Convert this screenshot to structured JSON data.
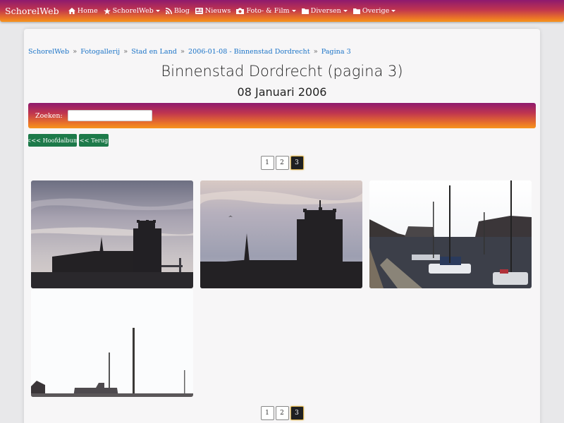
{
  "navbar": {
    "brand": "SchorelWeb",
    "items": [
      {
        "label": "Home",
        "icon": "home-icon",
        "dropdown": false
      },
      {
        "label": "SchorelWeb",
        "icon": "star-icon",
        "dropdown": true
      },
      {
        "label": "Blog",
        "icon": "rss-icon",
        "dropdown": false
      },
      {
        "label": "Nieuws",
        "icon": "newspaper-icon",
        "dropdown": false
      },
      {
        "label": "Foto- & Film",
        "icon": "camera-icon",
        "dropdown": true
      },
      {
        "label": "Diversen",
        "icon": "folder-icon",
        "dropdown": true
      },
      {
        "label": "Overige",
        "icon": "folder-icon",
        "dropdown": true
      }
    ]
  },
  "breadcrumb": {
    "items": [
      "SchorelWeb",
      "Fotogallerij",
      "Stad en Land",
      "2006-01-08 - Binnenstad Dordrecht",
      "Pagina 3"
    ],
    "separator": "»"
  },
  "page": {
    "title": "Binnenstad Dordrecht (pagina 3)",
    "subtitle": "08 Januari 2006"
  },
  "search": {
    "label": "Zoeken:",
    "value": ""
  },
  "buttons": {
    "main_album": "<<< Hoofdalbum",
    "back": "<< Terug"
  },
  "pagination": {
    "pages": [
      "1",
      "2",
      "3"
    ],
    "active": "3"
  },
  "colors": {
    "gradient_top": "#8e1a6e",
    "gradient_bottom": "#f7941d",
    "link": "#1a73c7",
    "button_green": "#1d7a4a",
    "active_page": "#1f2022"
  }
}
